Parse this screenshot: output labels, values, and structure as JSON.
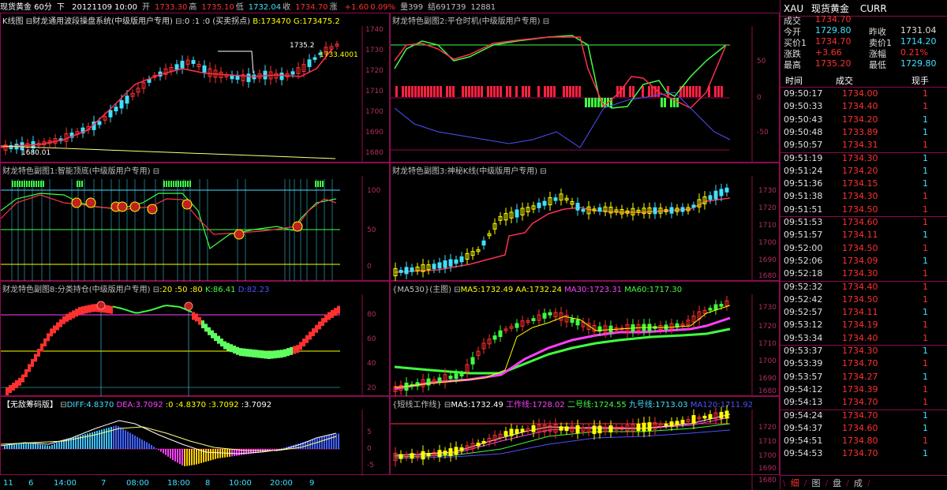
{
  "header": {
    "title": "现货黄金 60分",
    "period": "下",
    "date": "20121109 10:00",
    "open_label": "开",
    "open": "1733.30",
    "high_label": "高",
    "high": "1735.10",
    "low_label": "低",
    "low": "1732.04",
    "close_label": "收",
    "close": "1734.70",
    "chg_label": "涨",
    "chg": "+1.60",
    "pct": "0.09%",
    "vol_label": "量",
    "vol": "399",
    "amt": "结691739",
    "extra": "12881"
  },
  "panels": {
    "main": {
      "title": "K线图",
      "indicator": "财龙通用波段操盘系统(中级版用户专用)",
      "params": ":0 :1 :0 (买卖拐点)",
      "b": "B:173470",
      "g": "G:173475.2",
      "labels": [
        "1735.2",
        "1733.4001",
        "1680.01"
      ],
      "axis": [
        "1740",
        "1730",
        "1720",
        "1710",
        "1700",
        "1690",
        "1680"
      ]
    },
    "sub2": {
      "title": "财龙特色副图2:平仓时机(中级版用户专用)",
      "axis": [
        "50",
        "0",
        "-50"
      ]
    },
    "sub1": {
      "title": "财龙特色副图1:智能顶底(中级版用户专用)",
      "axis": [
        "100",
        "50",
        "0"
      ]
    },
    "sub3": {
      "title": "财龙特色副图3:神秘K线(中级版用户专用)",
      "axis": [
        "1730",
        "1720",
        "1710",
        "1700",
        "1690",
        "1680"
      ]
    },
    "sub8": {
      "title": "财龙特色副图8:分类持仓(中级版用户专用)",
      "params": ":20 :50 :80",
      "k": "K:86.41",
      "d": "D:82.23",
      "axis": [
        "80",
        "60",
        "40",
        "20"
      ]
    },
    "ma": {
      "title": "{MA530}(主图)",
      "ma5": "MA5:1732.49",
      "aa": "AA:1732.24",
      "ma30": "MA30:1723.31",
      "ma60": "MA60:1717.30",
      "axis": [
        "1730",
        "1720",
        "1710",
        "1700",
        "1690",
        "1680"
      ]
    },
    "macd": {
      "title": "【无敌筹码版】",
      "diff": "DIFF:4.8370",
      "dea": "DEA:3.7092",
      "p1": ":0",
      "p2": ":4.8370",
      "p3": ":3.7092",
      "p4": ":3.7092",
      "axis": [
        "5",
        "0",
        "-5"
      ]
    },
    "short": {
      "title": "{短线工作线}",
      "ma5": "MA5:1732.49",
      "gz": "工作线:1728.02",
      "eh": "二号线:1724.55",
      "jh": "九号线:1713.03",
      "ma120": "MA120:1711.92",
      "axis": [
        "1720",
        "1710",
        "1700",
        "1690",
        "1680"
      ]
    }
  },
  "xaxis": [
    "11",
    "6",
    "14:00",
    "7",
    "08:00",
    "18:00",
    "8",
    "10:00",
    "20:00",
    "9"
  ],
  "quote": {
    "symbol": "XAU",
    "name": "现货黄金",
    "code": "CURR",
    "last_label": "成交",
    "last": "1734.70",
    "open_label": "今开",
    "open": "1729.80",
    "prev_label": "昨收",
    "prev": "1731.04",
    "bid_label": "买价1",
    "bid": "1734.70",
    "ask_label": "卖价1",
    "ask": "1714.20",
    "chg_label": "涨跌",
    "chg": "+3.66",
    "pct_label": "涨幅",
    "pct": "0.21%",
    "high_label": "最高",
    "high": "1735.20",
    "low_label": "最低",
    "low": "1729.80"
  },
  "ticks_header": {
    "time": "时间",
    "price": "成交",
    "vol": "现手"
  },
  "ticks": [
    {
      "t": "09:50:17",
      "p": "1734.00",
      "v": "1",
      "c": "#ff3030"
    },
    {
      "t": "09:50:33",
      "p": "1734.40",
      "v": "1",
      "c": "#ff3030"
    },
    {
      "t": "09:50:43",
      "p": "1734.20",
      "v": "1",
      "c": "#40e0ff"
    },
    {
      "t": "09:50:48",
      "p": "1733.89",
      "v": "1",
      "c": "#40e0ff"
    },
    {
      "t": "09:50:57",
      "p": "1734.31",
      "v": "1",
      "c": "#ff3030"
    },
    {
      "t": "09:51:19",
      "p": "1734.30",
      "v": "1",
      "c": "#40e0ff"
    },
    {
      "t": "09:51:24",
      "p": "1734.20",
      "v": "1",
      "c": "#40e0ff"
    },
    {
      "t": "09:51:36",
      "p": "1734.15",
      "v": "1",
      "c": "#40e0ff"
    },
    {
      "t": "09:51:38",
      "p": "1734.30",
      "v": "1",
      "c": "#ff3030"
    },
    {
      "t": "09:51:51",
      "p": "1734.50",
      "v": "1",
      "c": "#ff3030"
    },
    {
      "t": "09:51:53",
      "p": "1734.60",
      "v": "1",
      "c": "#ff3030"
    },
    {
      "t": "09:51:57",
      "p": "1734.11",
      "v": "1",
      "c": "#40e0ff"
    },
    {
      "t": "09:52:00",
      "p": "1734.50",
      "v": "1",
      "c": "#ff3030"
    },
    {
      "t": "09:52:06",
      "p": "1734.09",
      "v": "1",
      "c": "#40e0ff"
    },
    {
      "t": "09:52:18",
      "p": "1734.30",
      "v": "1",
      "c": "#ff3030"
    },
    {
      "t": "09:52:32",
      "p": "1734.40",
      "v": "1",
      "c": "#ff3030"
    },
    {
      "t": "09:52:42",
      "p": "1734.50",
      "v": "1",
      "c": "#ff3030"
    },
    {
      "t": "09:52:57",
      "p": "1734.11",
      "v": "1",
      "c": "#40e0ff"
    },
    {
      "t": "09:53:12",
      "p": "1734.19",
      "v": "1",
      "c": "#ff3030"
    },
    {
      "t": "09:53:34",
      "p": "1734.40",
      "v": "1",
      "c": "#ff3030"
    },
    {
      "t": "09:53:37",
      "p": "1734.30",
      "v": "1",
      "c": "#40e0ff"
    },
    {
      "t": "09:53:39",
      "p": "1734.70",
      "v": "1",
      "c": "#ff3030"
    },
    {
      "t": "09:53:57",
      "p": "1734.27",
      "v": "1",
      "c": "#40e0ff"
    },
    {
      "t": "09:54:12",
      "p": "1734.39",
      "v": "1",
      "c": "#ff3030"
    },
    {
      "t": "09:54:13",
      "p": "1734.70",
      "v": "1",
      "c": "#ff3030"
    },
    {
      "t": "09:54:24",
      "p": "1734.70",
      "v": "1",
      "c": "#40e0ff"
    },
    {
      "t": "09:54:37",
      "p": "1734.60",
      "v": "1",
      "c": "#40e0ff"
    },
    {
      "t": "09:54:51",
      "p": "1734.80",
      "v": "1",
      "c": "#ff3030"
    },
    {
      "t": "09:54:53",
      "p": "1734.70",
      "v": "1",
      "c": "#40e0ff"
    }
  ],
  "tabs": [
    "细",
    "图",
    "盘",
    "成"
  ],
  "colors": {
    "up": "#ff3030",
    "down": "#40e0ff",
    "frame": "#8b0a50",
    "yellow": "#ffff00",
    "green": "#40ff40",
    "magenta": "#ff40ff",
    "white": "#ffffff"
  }
}
